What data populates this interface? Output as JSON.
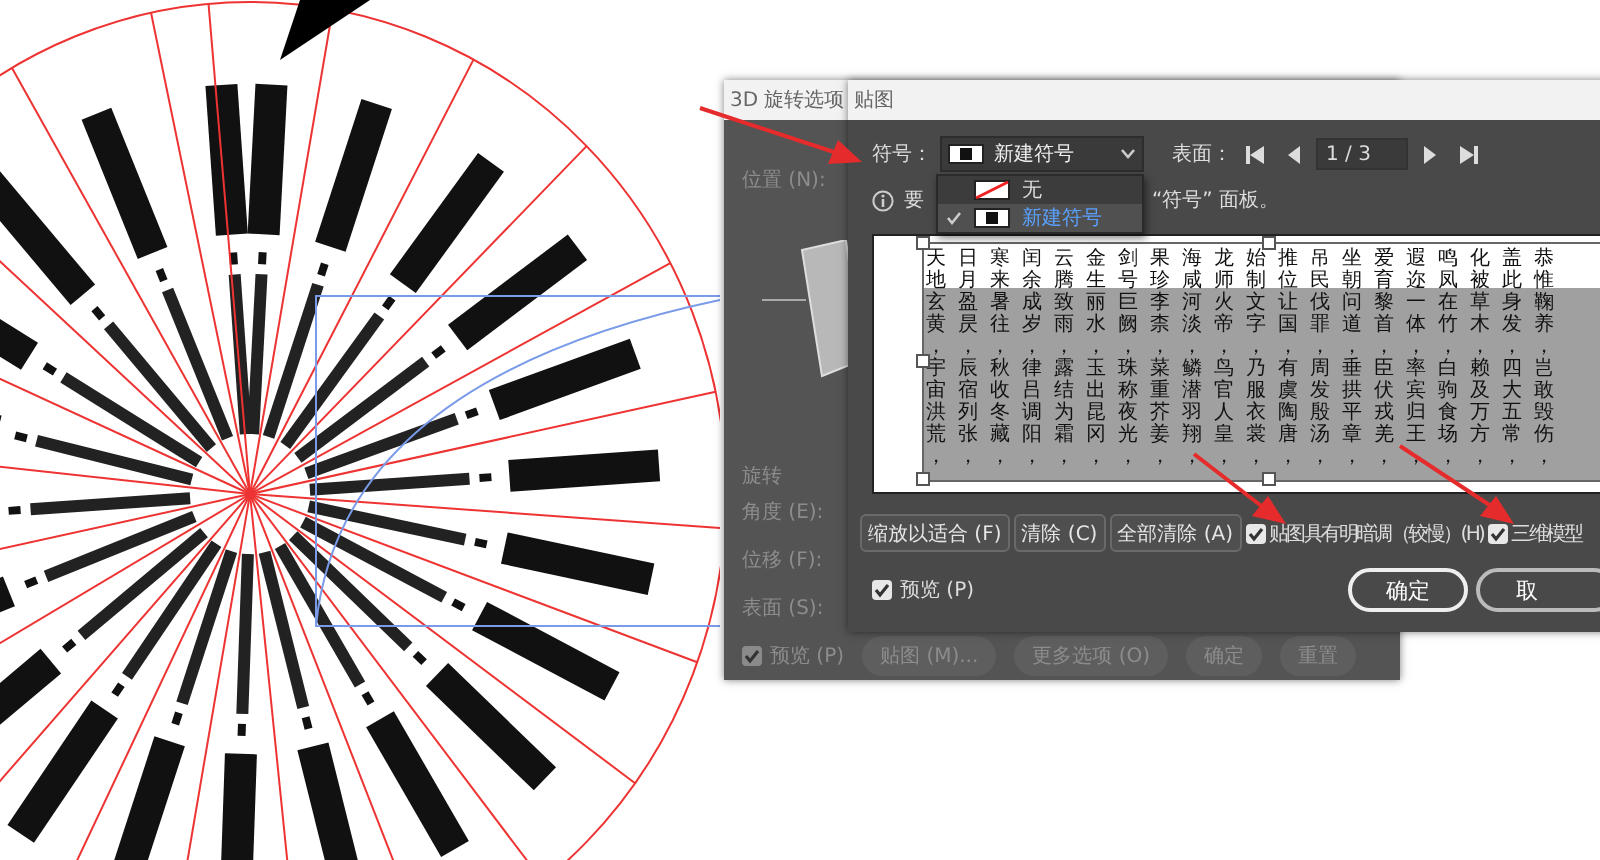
{
  "rotate_dialog": {
    "title": "3D 旋转选项",
    "position_label": "位置 (N):",
    "rotate_section": "旋转",
    "angle_label": "角度 (E):",
    "offset_label": "位移 (F):",
    "surface_label": "表面 (S):",
    "preview": {
      "label": "预览 (P)",
      "checked": true
    },
    "buttons": [
      "贴图 (M)...",
      "更多选项 (O)",
      "确定",
      "重置"
    ]
  },
  "map_art_dialog": {
    "title": "贴图",
    "symbol_label": "符号：",
    "symbol_value": "新建符号",
    "symbol_menu": [
      {
        "label": "无",
        "kind": "none",
        "selected": false
      },
      {
        "label": "新建符号",
        "kind": "symbol",
        "selected": true
      }
    ],
    "surface_label": "表面：",
    "surface_field": "1 / 3",
    "info": "要",
    "info_tail": "“符号” 面板。",
    "preview_columns": [
      "天地玄黄，宇宙洪荒，",
      "日月盈昃，辰宿列张，",
      "寒来暑往，秋收冬藏，",
      "闰余成岁，律吕调阳，",
      "云腾致雨，露结为霜，",
      "金生丽水，玉出昆冈，",
      "剑号巨阙，珠称夜光，",
      "果珍李柰，菜重芥姜，",
      "海咸河淡，鳞潜羽翔，",
      "龙师火帝，鸟官人皇，",
      "始制文字，乃服衣裳，",
      "推位让国，有虞陶唐，",
      "吊民伐罪，周发殷汤，",
      "坐朝问道，垂拱平章，",
      "爱育黎首，臣伏戎羌，",
      "遐迩一体，率宾归王，",
      "鸣凤在竹，白驹食场，",
      "化被草木，赖及万方，",
      "盖此身发，四大五常，",
      "恭惟鞠养，岂敢毁伤，"
    ],
    "buttons": [
      "缩放以适合 (F)",
      "清除 (C)",
      "全部清除 (A)"
    ],
    "options": [
      {
        "label": "贴图具有明暗调（较慢）(H)",
        "checked": true
      },
      {
        "label": "三维模型",
        "checked": true
      }
    ],
    "preview": {
      "label": "预览 (P)",
      "checked": true
    },
    "ok": "确定",
    "cancel": "取"
  }
}
